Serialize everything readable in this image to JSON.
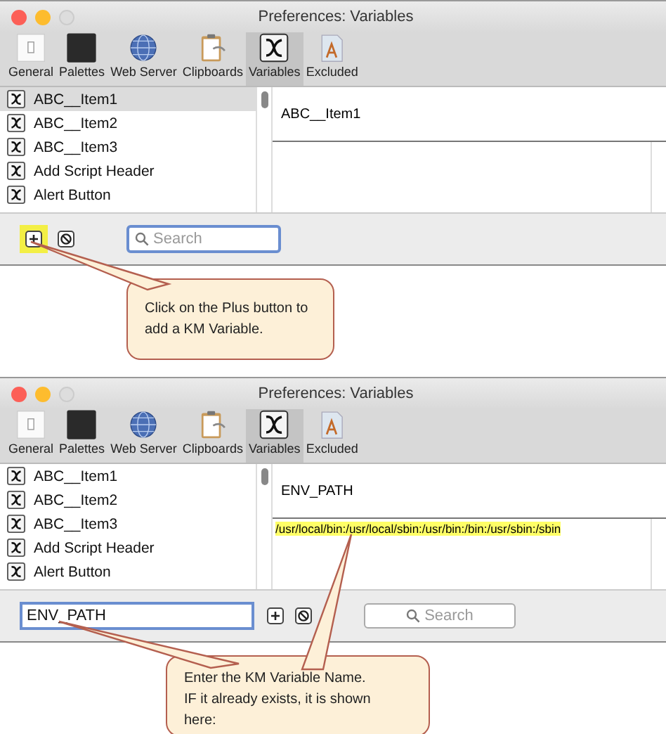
{
  "windows": [
    {
      "title": "Preferences: Variables",
      "toolbar": [
        {
          "label": "General",
          "kind": "general",
          "selected": false
        },
        {
          "label": "Palettes",
          "kind": "palettes",
          "selected": false
        },
        {
          "label": "Web Server",
          "kind": "globe",
          "selected": false
        },
        {
          "label": "Clipboards",
          "kind": "clipboard",
          "selected": false
        },
        {
          "label": "Variables",
          "kind": "variables",
          "selected": true
        },
        {
          "label": "Excluded",
          "kind": "excluded",
          "selected": false
        }
      ],
      "list": [
        {
          "name": "ABC__Item1",
          "selected": true
        },
        {
          "name": "ABC__Item2",
          "selected": false
        },
        {
          "name": "ABC__Item3",
          "selected": false
        },
        {
          "name": "Add Script Header",
          "selected": false
        },
        {
          "name": "Alert Button",
          "selected": false
        }
      ],
      "detail": {
        "name": "ABC__Item1"
      },
      "controls": [
        {
          "kind": "add",
          "highlighted": true
        },
        {
          "kind": "remove"
        },
        {
          "kind": "search",
          "placeholder": "Search",
          "focused": true
        }
      ]
    },
    {
      "title": "Preferences: Variables",
      "toolbar": [
        {
          "label": "General",
          "kind": "general",
          "selected": false
        },
        {
          "label": "Palettes",
          "kind": "palettes",
          "selected": false
        },
        {
          "label": "Web Server",
          "kind": "globe",
          "selected": false
        },
        {
          "label": "Clipboards",
          "kind": "clipboard",
          "selected": false
        },
        {
          "label": "Variables",
          "kind": "variables",
          "selected": true
        },
        {
          "label": "Excluded",
          "kind": "excluded",
          "selected": false
        }
      ],
      "list": [
        {
          "name": "ABC__Item1",
          "selected": false
        },
        {
          "name": "ABC__Item2",
          "selected": false
        },
        {
          "name": "ABC__Item3",
          "selected": false
        },
        {
          "name": "Add Script Header",
          "selected": false
        },
        {
          "name": "Alert Button",
          "selected": false
        }
      ],
      "detail": {
        "name": "ENV_PATH",
        "value": "/usr/local/bin:/usr/local/sbin:/usr/bin:/bin:/usr/sbin:/sbin",
        "value_highlighted": true
      },
      "controls": [
        {
          "kind": "name-field",
          "value": "ENV_PATH",
          "focused": true
        },
        {
          "kind": "add",
          "highlighted": false
        },
        {
          "kind": "remove"
        },
        {
          "kind": "search",
          "placeholder": "Search",
          "focused": false
        }
      ]
    }
  ],
  "callouts": [
    {
      "text": "Click on the Plus button to add a KM Variable."
    },
    {
      "text": "Enter the KM Variable Name. IF it already exists, it is shown here:"
    }
  ]
}
